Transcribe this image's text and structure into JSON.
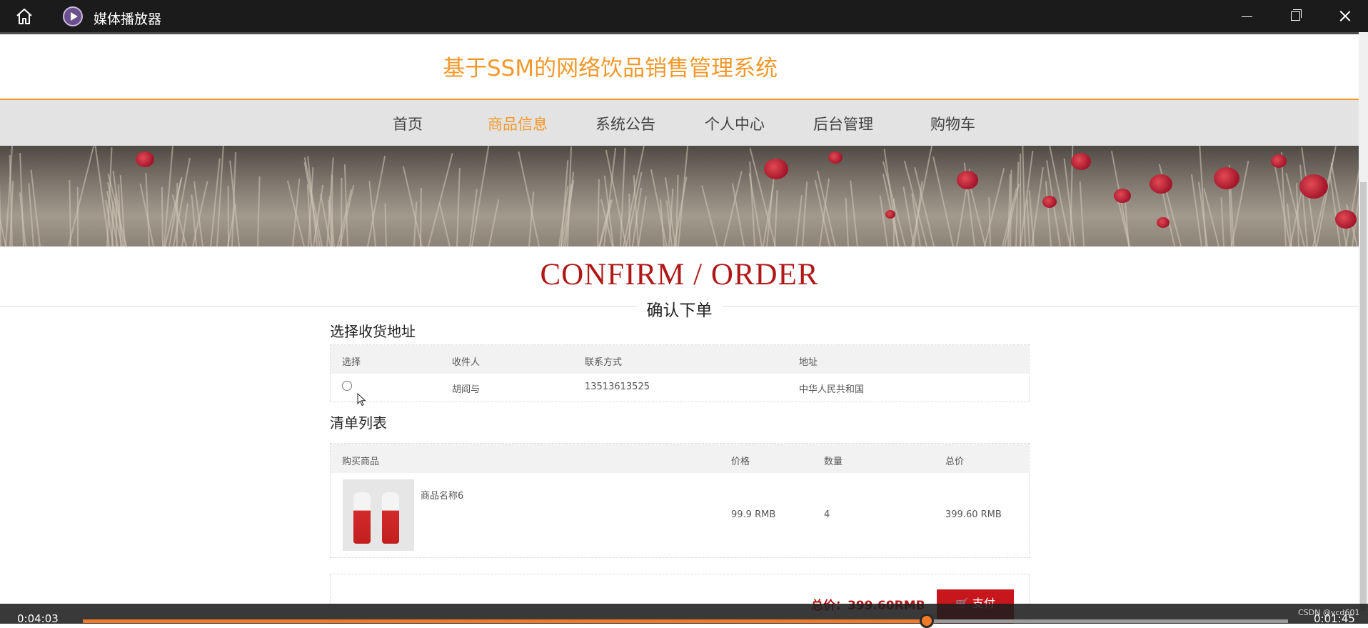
{
  "window": {
    "title": "媒体播放器"
  },
  "site": {
    "title": "基于SSM的网络饮品销售管理系统"
  },
  "nav": [
    {
      "label": "首页",
      "active": false
    },
    {
      "label": "商品信息",
      "active": true
    },
    {
      "label": "系统公告",
      "active": false
    },
    {
      "label": "个人中心",
      "active": false
    },
    {
      "label": "后台管理",
      "active": false
    },
    {
      "label": "购物车",
      "active": false
    }
  ],
  "heading": {
    "title": "CONFIRM / ORDER",
    "subtitle": "确认下单"
  },
  "address": {
    "section_title": "选择收货地址",
    "headers": {
      "select": "选择",
      "receiver": "收件人",
      "phone": "联系方式",
      "address": "地址"
    },
    "rows": [
      {
        "selected": false,
        "receiver": "胡阎与",
        "phone": "13513613525",
        "address": "中华人民共和国"
      }
    ]
  },
  "cart": {
    "section_title": "清单列表",
    "headers": {
      "product": "购买商品",
      "price": "价格",
      "quantity": "数量",
      "total": "总价"
    },
    "rows": [
      {
        "name": "商品名称6",
        "price": "99.9 RMB",
        "quantity": "4",
        "total": "399.60 RMB"
      }
    ]
  },
  "payment": {
    "total_label": "总价：399.60RMB",
    "pay_label": "支付"
  },
  "player": {
    "elapsed": "0:04:03",
    "remaining": "0:01:45",
    "progress": 0.7,
    "watermark": "CSDN @ycd601"
  },
  "colors": {
    "accent": "#f3982b",
    "brand_red": "#b01818",
    "pay_button": "#c8161d",
    "player_progress": "#f07a2a"
  }
}
